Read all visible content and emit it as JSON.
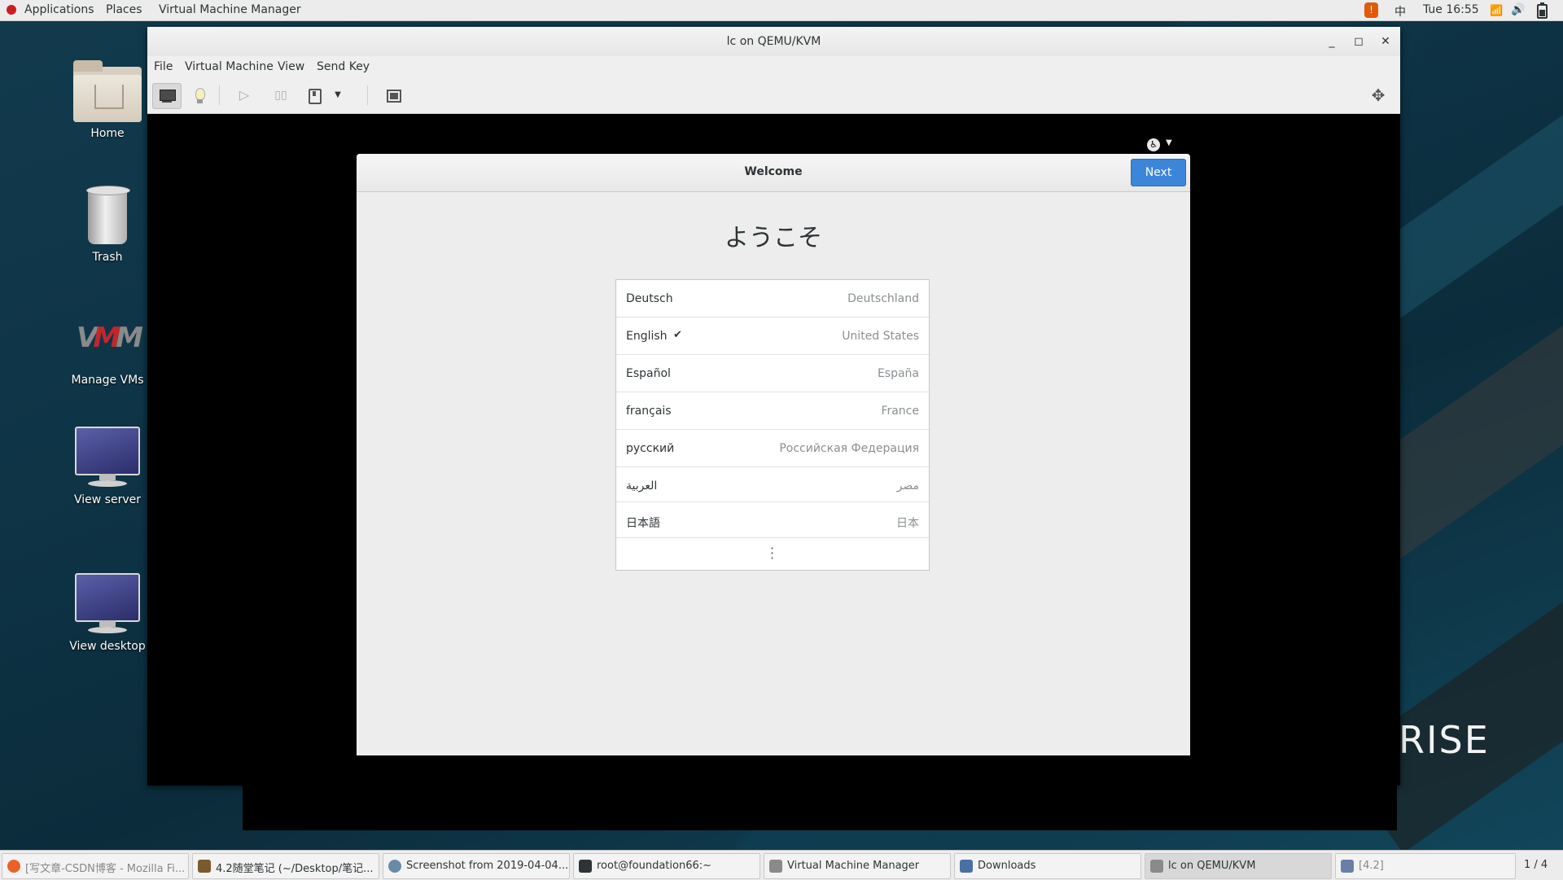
{
  "topbar": {
    "applications": "Applications",
    "places": "Places",
    "app_name": "Virtual Machine Manager",
    "ime": "中",
    "clock": "Tue 16:55"
  },
  "desktop_icons": {
    "home": "Home",
    "trash": "Trash",
    "manage_vms": "Manage VMs",
    "view_server": "View server",
    "view_desktop": "View desktop"
  },
  "desktop_brand_text": "RISE",
  "vm_window": {
    "title": "lc on QEMU/KVM",
    "menu": [
      "File",
      "Virtual Machine",
      "View",
      "Send Key"
    ]
  },
  "guest": {
    "dialog_title": "Welcome",
    "next_label": "Next",
    "heading": "ようこそ",
    "languages": [
      {
        "name": "Deutsch",
        "region": "Deutschland",
        "selected": false
      },
      {
        "name": "English",
        "region": "United States",
        "selected": true
      },
      {
        "name": "Español",
        "region": "España",
        "selected": false
      },
      {
        "name": "français",
        "region": "France",
        "selected": false
      },
      {
        "name": "русский",
        "region": "Российская Федерация",
        "selected": false
      },
      {
        "name": "العربية",
        "region": "مصر",
        "selected": false
      },
      {
        "name": "日本語",
        "region": "日本",
        "selected": false
      }
    ],
    "check_mark": "✔"
  },
  "taskbar": {
    "items": [
      {
        "label": "[写文章-CSDN博客 - Mozilla Fi...",
        "icon": "firefox-icon",
        "color": "#e8632b"
      },
      {
        "label": "4.2随堂笔记 (~/Desktop/笔记...",
        "icon": "text-editor-icon",
        "color": "#7a5a2e"
      },
      {
        "label": "Screenshot from 2019-04-04...",
        "icon": "image-viewer-icon",
        "color": "#6a8aa8"
      },
      {
        "label": "root@foundation66:~",
        "icon": "terminal-icon",
        "color": "#2e3436"
      },
      {
        "label": "Virtual Machine Manager",
        "icon": "vmm-icon",
        "color": "#8a8a8a"
      },
      {
        "label": "Downloads",
        "icon": "folder-icon",
        "color": "#4a6fa5"
      },
      {
        "label": "lc on QEMU/KVM",
        "icon": "vm-console-icon",
        "color": "#8a8a8a"
      },
      {
        "label": "[4.2]",
        "icon": "document-icon",
        "color": "#6a7fa5"
      }
    ],
    "workspace": "1 / 4"
  }
}
